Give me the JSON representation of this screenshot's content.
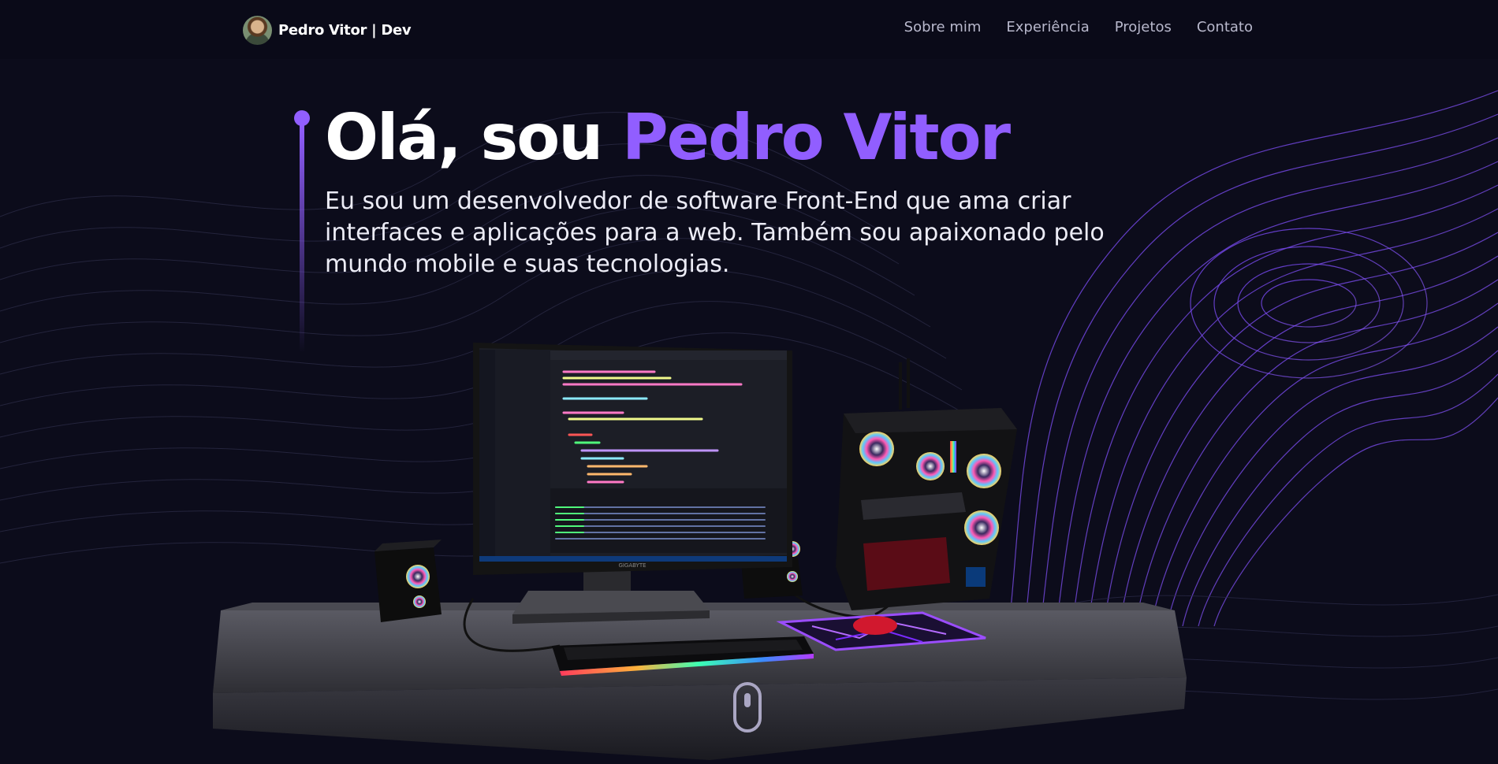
{
  "brand": {
    "name": "Pedro Vitor | Dev"
  },
  "nav": {
    "items": [
      {
        "label": "Sobre mim"
      },
      {
        "label": "Experiência"
      },
      {
        "label": "Projetos"
      },
      {
        "label": "Contato"
      }
    ]
  },
  "hero": {
    "greeting": "Olá, sou ",
    "name": "Pedro Vitor",
    "subtitle": "Eu sou um desenvolvedor de software Front-End que ama criar interfaces e aplicações para a web. Também sou apaixonado pelo mundo mobile e suas tecnologias."
  },
  "scene": {
    "monitor_brand": "GIGABYTE",
    "icons": [
      "desk-setup-3d",
      "mouse-scroll-icon"
    ]
  },
  "colors": {
    "accent": "#915eff",
    "background": "#0c0c1b",
    "text": "#ffffff",
    "nav_text": "#b8b8cc"
  }
}
